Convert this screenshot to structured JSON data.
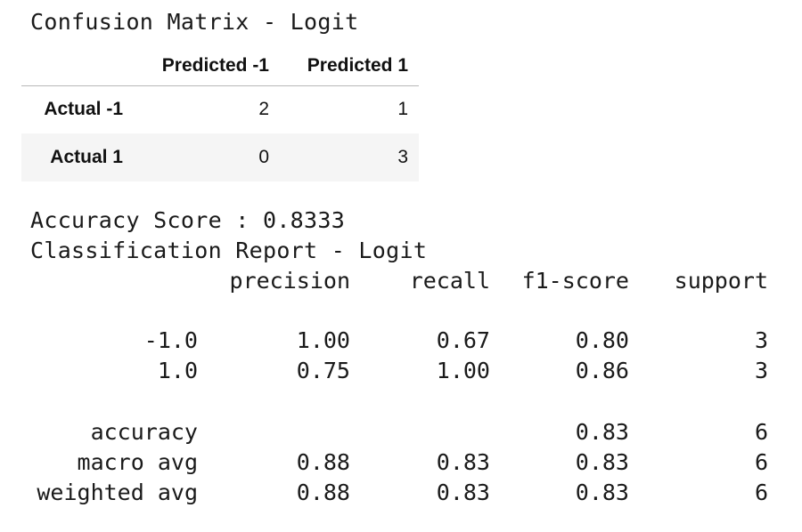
{
  "confusion_matrix": {
    "title": "Confusion Matrix - Logit",
    "columns": [
      "Predicted -1",
      "Predicted 1"
    ],
    "rows": [
      {
        "label": "Actual -1",
        "values": [
          "2",
          "1"
        ]
      },
      {
        "label": "Actual 1",
        "values": [
          "0",
          "3"
        ]
      }
    ]
  },
  "accuracy": {
    "text": "Accuracy Score : 0.8333"
  },
  "report": {
    "title": "Classification Report - Logit",
    "headers": [
      "precision",
      "recall",
      "f1-score",
      "support"
    ],
    "rows": [
      {
        "label": "-1.0",
        "values": [
          "1.00",
          "0.67",
          "0.80",
          "3"
        ]
      },
      {
        "label": "1.0",
        "values": [
          "0.75",
          "1.00",
          "0.86",
          "3"
        ]
      },
      {
        "label": "accuracy",
        "values": [
          "",
          "",
          "0.83",
          "6"
        ]
      },
      {
        "label": "macro avg",
        "values": [
          "0.88",
          "0.83",
          "0.83",
          "6"
        ]
      },
      {
        "label": "weighted avg",
        "values": [
          "0.88",
          "0.83",
          "0.83",
          "6"
        ]
      }
    ]
  }
}
